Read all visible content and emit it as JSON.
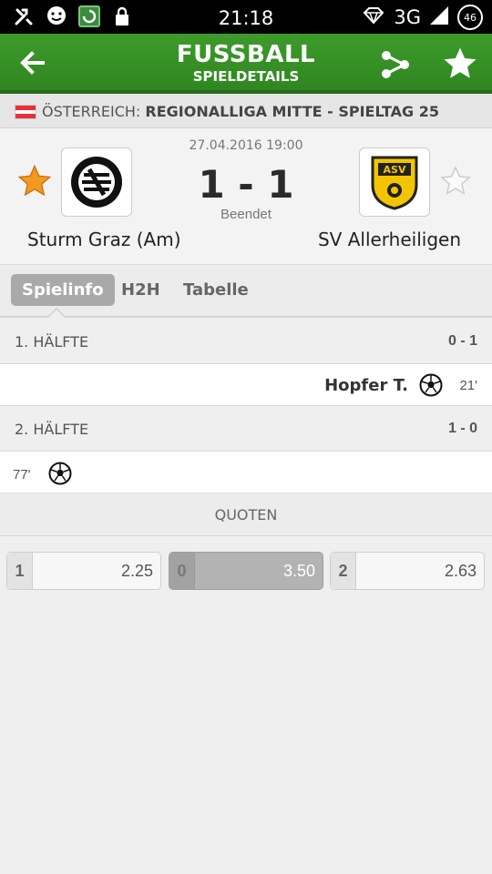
{
  "status_bar": {
    "time": "21:18",
    "network": "3G",
    "battery": "46",
    "icons": [
      "tools-icon",
      "chat-smiley-icon",
      "app-refresh-icon",
      "lock-icon",
      "diamond-icon",
      "signal-icon",
      "battery-icon"
    ]
  },
  "header": {
    "title": "FUSSBALL",
    "subtitle": "SPIELDETAILS"
  },
  "league": {
    "country": "ÖSTERREICH:",
    "name": "REGIONALLIGA MITTE - SPIELTAG 25",
    "flag_colors": [
      "#e8303a",
      "#ffffff",
      "#e8303a"
    ]
  },
  "match": {
    "datetime": "27.04.2016 19:00",
    "score": "1 - 1",
    "status": "Beendet",
    "home": {
      "name": "Sturm Graz (Am)",
      "favorite": true
    },
    "away": {
      "name": "SV Allerheiligen",
      "favorite": false,
      "logo_text": "ASV"
    }
  },
  "tabs": [
    {
      "label": "Spielinfo",
      "active": true
    },
    {
      "label": "H2H",
      "active": false
    },
    {
      "label": "Tabelle",
      "active": false
    }
  ],
  "halves": [
    {
      "label": "1. HÄLFTE",
      "score": "0 - 1"
    },
    {
      "label": "2. HÄLFTE",
      "score": "1 - 0"
    }
  ],
  "events": [
    {
      "player": "Hopfer T.",
      "minute": "21'",
      "team": "away",
      "type": "goal"
    },
    {
      "player": "",
      "minute": "77'",
      "team": "home",
      "type": "goal"
    }
  ],
  "odds_section": {
    "title": "QUOTEN",
    "odds": [
      {
        "label": "1",
        "value": "2.25",
        "selected": false
      },
      {
        "label": "0",
        "value": "3.50",
        "selected": true
      },
      {
        "label": "2",
        "value": "2.63",
        "selected": false
      }
    ]
  },
  "colors": {
    "header_green": "#3d9b2a",
    "favorite_star": "#f09a1f"
  }
}
